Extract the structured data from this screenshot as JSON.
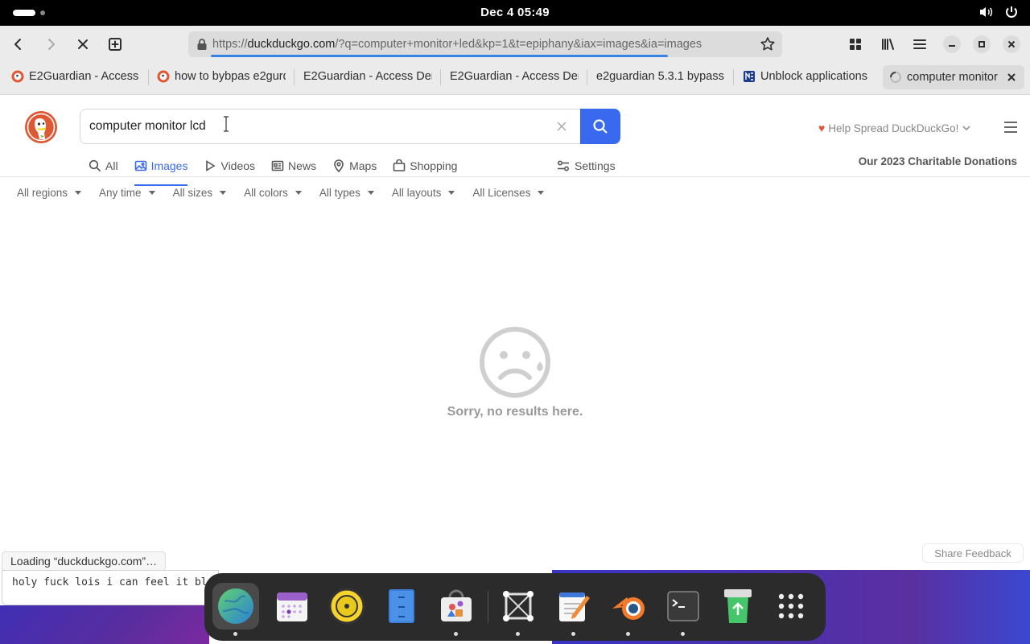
{
  "system_bar": {
    "clock": "Dec 4  05:49",
    "icons": [
      "volume-icon",
      "power-icon"
    ]
  },
  "browser": {
    "url_scheme": "https://",
    "url_domain": "duckduckgo.com",
    "url_rest": "/?q=computer+monitor+led&kp=1&t=epiphany&iax=images&ia=images",
    "load_progress": 0.77,
    "tabs": [
      {
        "label": "E2Guardian - Access",
        "favicon": "ddg-favicon"
      },
      {
        "label": "how to bybpas e2gurd",
        "favicon": "ddg-favicon"
      },
      {
        "label": "E2Guardian - Access Den",
        "favicon": "none"
      },
      {
        "label": "E2Guardian - Access Den",
        "favicon": "none"
      },
      {
        "label": "e2guardian 5.3.1 bypass",
        "favicon": "none"
      },
      {
        "label": "Unblock applications",
        "favicon": "site-favicon"
      },
      {
        "label": "computer monitor",
        "favicon": "loading-spinner"
      }
    ]
  },
  "search": {
    "query": "computer monitor lcd",
    "spread_label": "Help Spread DuckDuckGo!",
    "donations_label": "Our 2023 Charitable Donations",
    "nav": [
      {
        "label": "All",
        "icon": "search-icon"
      },
      {
        "label": "Images",
        "icon": "image-icon"
      },
      {
        "label": "Videos",
        "icon": "play-icon"
      },
      {
        "label": "News",
        "icon": "newspaper-icon"
      },
      {
        "label": "Maps",
        "icon": "map-pin-icon"
      },
      {
        "label": "Shopping",
        "icon": "shopping-bag-icon"
      }
    ],
    "active_nav": "Images",
    "settings_label": "Settings",
    "filters": [
      "All regions",
      "Any time",
      "All sizes",
      "All colors",
      "All types",
      "All layouts",
      "All Licenses"
    ],
    "no_results": "Sorry, no results here.",
    "feedback_label": "Share Feedback"
  },
  "status": {
    "loading": "Loading “duckduckgo.com”…"
  },
  "terminal": {
    "text": "holy fuck lois i can feel it bl"
  },
  "dock": [
    {
      "name": "web-browser",
      "active": true,
      "running": true
    },
    {
      "name": "calendar",
      "active": false,
      "running": false
    },
    {
      "name": "rhythmbox",
      "active": false,
      "running": false
    },
    {
      "name": "file-manager",
      "active": false,
      "running": false
    },
    {
      "name": "software-store",
      "active": false,
      "running": true
    },
    {
      "name": "screenshot-tool",
      "active": false,
      "running": true
    },
    {
      "name": "text-editor",
      "active": false,
      "running": true
    },
    {
      "name": "blender",
      "active": false,
      "running": true
    },
    {
      "name": "terminal",
      "active": false,
      "running": true
    },
    {
      "name": "trash",
      "active": false,
      "running": false
    },
    {
      "name": "app-grid",
      "active": false,
      "running": false
    }
  ],
  "colors": {
    "accent": "#3969ef",
    "ddg_orange": "#de5833",
    "progress": "#3584e4"
  }
}
